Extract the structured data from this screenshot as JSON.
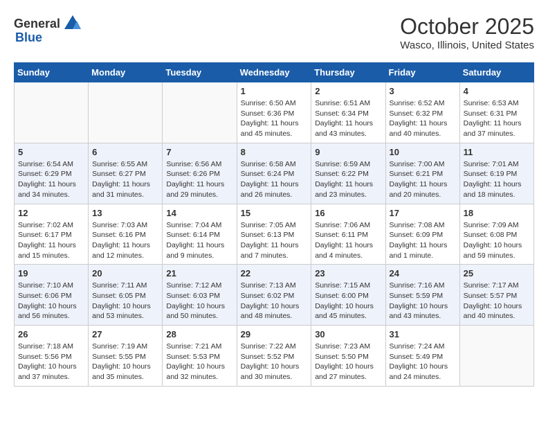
{
  "header": {
    "logo_general": "General",
    "logo_blue": "Blue",
    "month_title": "October 2025",
    "location": "Wasco, Illinois, United States"
  },
  "days_of_week": [
    "Sunday",
    "Monday",
    "Tuesday",
    "Wednesday",
    "Thursday",
    "Friday",
    "Saturday"
  ],
  "weeks": [
    [
      {
        "day": "",
        "info": ""
      },
      {
        "day": "",
        "info": ""
      },
      {
        "day": "",
        "info": ""
      },
      {
        "day": "1",
        "info": "Sunrise: 6:50 AM\nSunset: 6:36 PM\nDaylight: 11 hours and 45 minutes."
      },
      {
        "day": "2",
        "info": "Sunrise: 6:51 AM\nSunset: 6:34 PM\nDaylight: 11 hours and 43 minutes."
      },
      {
        "day": "3",
        "info": "Sunrise: 6:52 AM\nSunset: 6:32 PM\nDaylight: 11 hours and 40 minutes."
      },
      {
        "day": "4",
        "info": "Sunrise: 6:53 AM\nSunset: 6:31 PM\nDaylight: 11 hours and 37 minutes."
      }
    ],
    [
      {
        "day": "5",
        "info": "Sunrise: 6:54 AM\nSunset: 6:29 PM\nDaylight: 11 hours and 34 minutes."
      },
      {
        "day": "6",
        "info": "Sunrise: 6:55 AM\nSunset: 6:27 PM\nDaylight: 11 hours and 31 minutes."
      },
      {
        "day": "7",
        "info": "Sunrise: 6:56 AM\nSunset: 6:26 PM\nDaylight: 11 hours and 29 minutes."
      },
      {
        "day": "8",
        "info": "Sunrise: 6:58 AM\nSunset: 6:24 PM\nDaylight: 11 hours and 26 minutes."
      },
      {
        "day": "9",
        "info": "Sunrise: 6:59 AM\nSunset: 6:22 PM\nDaylight: 11 hours and 23 minutes."
      },
      {
        "day": "10",
        "info": "Sunrise: 7:00 AM\nSunset: 6:21 PM\nDaylight: 11 hours and 20 minutes."
      },
      {
        "day": "11",
        "info": "Sunrise: 7:01 AM\nSunset: 6:19 PM\nDaylight: 11 hours and 18 minutes."
      }
    ],
    [
      {
        "day": "12",
        "info": "Sunrise: 7:02 AM\nSunset: 6:17 PM\nDaylight: 11 hours and 15 minutes."
      },
      {
        "day": "13",
        "info": "Sunrise: 7:03 AM\nSunset: 6:16 PM\nDaylight: 11 hours and 12 minutes."
      },
      {
        "day": "14",
        "info": "Sunrise: 7:04 AM\nSunset: 6:14 PM\nDaylight: 11 hours and 9 minutes."
      },
      {
        "day": "15",
        "info": "Sunrise: 7:05 AM\nSunset: 6:13 PM\nDaylight: 11 hours and 7 minutes."
      },
      {
        "day": "16",
        "info": "Sunrise: 7:06 AM\nSunset: 6:11 PM\nDaylight: 11 hours and 4 minutes."
      },
      {
        "day": "17",
        "info": "Sunrise: 7:08 AM\nSunset: 6:09 PM\nDaylight: 11 hours and 1 minute."
      },
      {
        "day": "18",
        "info": "Sunrise: 7:09 AM\nSunset: 6:08 PM\nDaylight: 10 hours and 59 minutes."
      }
    ],
    [
      {
        "day": "19",
        "info": "Sunrise: 7:10 AM\nSunset: 6:06 PM\nDaylight: 10 hours and 56 minutes."
      },
      {
        "day": "20",
        "info": "Sunrise: 7:11 AM\nSunset: 6:05 PM\nDaylight: 10 hours and 53 minutes."
      },
      {
        "day": "21",
        "info": "Sunrise: 7:12 AM\nSunset: 6:03 PM\nDaylight: 10 hours and 50 minutes."
      },
      {
        "day": "22",
        "info": "Sunrise: 7:13 AM\nSunset: 6:02 PM\nDaylight: 10 hours and 48 minutes."
      },
      {
        "day": "23",
        "info": "Sunrise: 7:15 AM\nSunset: 6:00 PM\nDaylight: 10 hours and 45 minutes."
      },
      {
        "day": "24",
        "info": "Sunrise: 7:16 AM\nSunset: 5:59 PM\nDaylight: 10 hours and 43 minutes."
      },
      {
        "day": "25",
        "info": "Sunrise: 7:17 AM\nSunset: 5:57 PM\nDaylight: 10 hours and 40 minutes."
      }
    ],
    [
      {
        "day": "26",
        "info": "Sunrise: 7:18 AM\nSunset: 5:56 PM\nDaylight: 10 hours and 37 minutes."
      },
      {
        "day": "27",
        "info": "Sunrise: 7:19 AM\nSunset: 5:55 PM\nDaylight: 10 hours and 35 minutes."
      },
      {
        "day": "28",
        "info": "Sunrise: 7:21 AM\nSunset: 5:53 PM\nDaylight: 10 hours and 32 minutes."
      },
      {
        "day": "29",
        "info": "Sunrise: 7:22 AM\nSunset: 5:52 PM\nDaylight: 10 hours and 30 minutes."
      },
      {
        "day": "30",
        "info": "Sunrise: 7:23 AM\nSunset: 5:50 PM\nDaylight: 10 hours and 27 minutes."
      },
      {
        "day": "31",
        "info": "Sunrise: 7:24 AM\nSunset: 5:49 PM\nDaylight: 10 hours and 24 minutes."
      },
      {
        "day": "",
        "info": ""
      }
    ]
  ]
}
